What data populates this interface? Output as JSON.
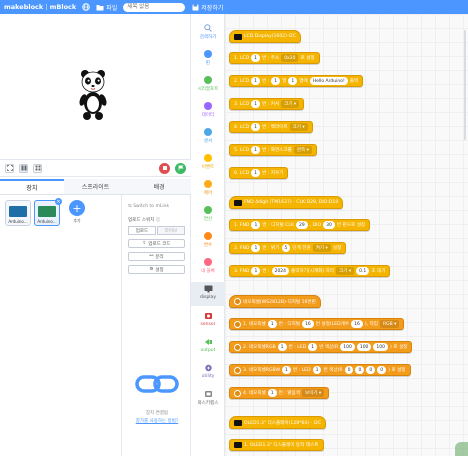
{
  "topbar": {
    "logo": "makeblock",
    "product": "mBlock",
    "file_label": "파일",
    "title_placeholder": "제목 없음",
    "save_label": "저장하기"
  },
  "stage_toolbar": {
    "stop_icon": "stop-icon",
    "go_icon": "flag-icon"
  },
  "tabs": [
    {
      "label": "장치"
    },
    {
      "label": "스프라이트"
    },
    {
      "label": "배경"
    }
  ],
  "devices": [
    {
      "label": "Arduino..."
    },
    {
      "label": "Arduino..."
    }
  ],
  "add_device": {
    "label": "추가"
  },
  "connection": {
    "switch_link": "Switch to mLink",
    "mode_label": "업로드 스위치 ⓘ",
    "mode_live": "업로드",
    "mode_upload": "라이브",
    "upload_btn": "업로드 코드",
    "disconnect_btn": "분리",
    "settings_btn": "설정",
    "bottom_text": "장치 연결됨",
    "bottom_link": "참가를 사용하는 방법?"
  },
  "categories": [
    {
      "label": "검색하기",
      "color": "#7aa3d6"
    },
    {
      "label": "핀",
      "color": "#4c97ff"
    },
    {
      "label": "시리얼포트",
      "color": "#59c059"
    },
    {
      "label": "데이터",
      "color": "#9966ff"
    },
    {
      "label": "센서",
      "color": "#4fa8e6"
    },
    {
      "label": "이벤트",
      "color": "#ffbf00"
    },
    {
      "label": "제어",
      "color": "#ffab19"
    },
    {
      "label": "연산",
      "color": "#59c059"
    },
    {
      "label": "변수",
      "color": "#ff8c1a"
    },
    {
      "label": "내 블록",
      "color": "#ff6680"
    },
    {
      "label": "display",
      "color": "#555555"
    },
    {
      "label": "sensor",
      "color": "#d63d3d"
    },
    {
      "label": "output",
      "color": "#59c059"
    },
    {
      "label": "utility",
      "color": "#7a6fb4"
    },
    {
      "label": "와스키랩스",
      "color": "#888888"
    }
  ],
  "blocks": {
    "lcd_hat": "LCD Display(1602)-I2C",
    "lcd1": {
      "num": "1. LCD",
      "pin": "1",
      "t1": "번 : 주소",
      "addr": "0x20",
      "t2": "로 설정"
    },
    "lcd2": {
      "num": "2. LCD",
      "pin": "1",
      "t1": "번 :",
      "col": "1",
      "t2": "열",
      "row": "1",
      "t3": "행에",
      "text": "Hello Arduino!",
      "t4": "출력"
    },
    "lcd3": {
      "num": "3. LCD",
      "pin": "1",
      "t1": "번 : 커서",
      "opt": "크기 ▾"
    },
    "lcd4": {
      "num": "4. LCD",
      "pin": "1",
      "t1": "번 : 백라이트",
      "opt": "크기 ▾"
    },
    "lcd5": {
      "num": "5. LCD",
      "pin": "1",
      "t1": "번 : 화면스크롤",
      "opt": "왼쪽 ▾"
    },
    "lcd6": {
      "num": "6. LCD",
      "pin": "1",
      "t1": "번 : 지우기"
    },
    "fnd_hat": "FND 4digit (TM1637) - CLK:D29, DIO:D10",
    "fnd1": {
      "num": "1. FND",
      "pin": "1",
      "t1": "번 : 디지털 CLK",
      "clk": "29",
      "t2": ", DIO",
      "dio": "30",
      "t3": "번 핀으로 설정"
    },
    "fnd2": {
      "num": "2. FND",
      "pin": "1",
      "t1": "번 : 밝기",
      "bright": "5",
      "t2": "단계 전원",
      "opt": "켜기 ▾",
      "t3": "설정"
    },
    "fnd3": {
      "num": "3. FND",
      "pin": "1",
      "t1": "번 :",
      "val": "2024",
      "t2": "출력하기(시계화) 자리",
      "opt": "크기 ▾",
      "delay": "0.1",
      "t3": "초 대기"
    },
    "neo_hat": "네오픽셀(WS2812B)-디지털 16번핀",
    "neo1": {
      "num": "1. 네오픽셀",
      "pin": "1",
      "t1": "번 : 디지털",
      "dpin": "16",
      "t2": "번 설정(LED개수",
      "count": "16",
      "t3": "), 타입",
      "opt": "RGB ▾"
    },
    "neo2": {
      "num": "2. 네오픽셀RGB",
      "pin": "1",
      "t1": "번 : LED",
      "led": "1",
      "t2": "번 색상(R",
      "r": "100",
      "g": "100",
      "b": "100",
      "t3": ") 로 설정"
    },
    "neo3": {
      "num": "3. 네오픽셀RGBW",
      "pin": "1",
      "t1": "번 : LED",
      "led": "1",
      "t2": "번 색상(R",
      "r": "0",
      "g": "0",
      "b": "0",
      "w": "0",
      "t3": ") 로 설정"
    },
    "neo4": {
      "num": "4. 네오픽셀",
      "pin": "1",
      "t1": "번 : 밝음색",
      "opt": "보이기 ▾"
    },
    "oled_hat": "OLED1.3\" 디스플레이(128*64) - I2C",
    "oled1": {
      "num": "1. OLED1.3\" 디스플레이 동작 테스트"
    }
  }
}
